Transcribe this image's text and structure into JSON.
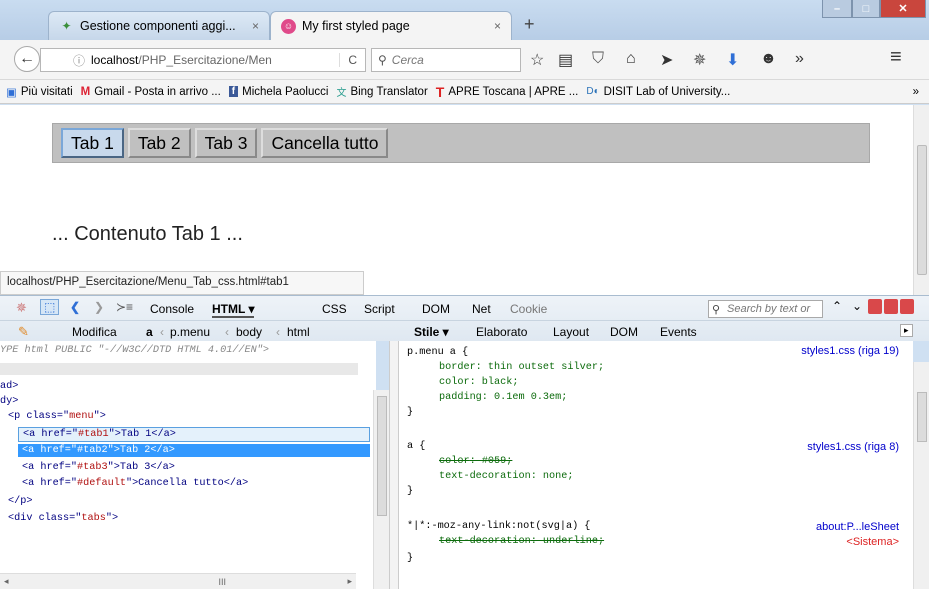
{
  "browser": {
    "tabs": [
      {
        "label": "Gestione componenti aggi...",
        "icon": "puzzle-icon",
        "close": "×"
      },
      {
        "label": "My first styled page",
        "icon": "page-icon",
        "close": "×"
      }
    ],
    "new_tab": "+",
    "url_host": "localhost",
    "url_path": "/PHP_Esercitazione/Men",
    "reload": "C",
    "search_placeholder": "Cerca",
    "overflow": "»",
    "menu": "≡"
  },
  "bookmarks": [
    {
      "label": "Più visitati",
      "icon": "visited-icon"
    },
    {
      "label": "Gmail - Posta in arrivo ...",
      "icon": "gmail-icon"
    },
    {
      "label": "Michela Paolucci",
      "icon": "facebook-icon"
    },
    {
      "label": "Bing Translator",
      "icon": "translate-icon"
    },
    {
      "label": "APRE Toscana | APRE ...",
      "icon": "apre-icon"
    },
    {
      "label": "DISIT Lab of University...",
      "icon": "disit-icon"
    }
  ],
  "page": {
    "menu_buttons": [
      "Tab 1",
      "Tab 2",
      "Tab 3",
      "Cancella tutto"
    ],
    "content": "... Contenuto Tab 1 ...",
    "status_url": "localhost/PHP_Esercitazione/Menu_Tab_css.html#tab1"
  },
  "firebug": {
    "toolbar_tabs": [
      "Console",
      "HTML ▾",
      "CSS",
      "Script",
      "DOM",
      "Net",
      "Cookie"
    ],
    "search_placeholder": "Search by text or",
    "edit": "Modifica",
    "breadcrumb": [
      "a",
      "p.menu",
      "body",
      "html"
    ],
    "side_tabs": [
      "Stile ▾",
      "Elaborato",
      "Layout",
      "DOM",
      "Events"
    ]
  },
  "html_lines": {
    "l1": "YPE html PUBLIC \"-//W3C//DTD HTML 4.01//EN\">",
    "l2": "ad>",
    "l3": "dy>",
    "p_open_a": "<p class=\"",
    "p_open_b": "menu",
    "p_open_c": "\">",
    "a1_a": "<a href=\"",
    "a1_b": "#tab1",
    "a1_c": "\">Tab 1</a>",
    "a2_a": "<a href=\"",
    "a2_b": "#tab2",
    "a2_c": "\">Tab 2</a>",
    "a3_a": "<a href=\"",
    "a3_b": "#tab3",
    "a3_c": "\">Tab 3</a>",
    "a4_a": "<a href=\"",
    "a4_b": "#default",
    "a4_c": "\">Cancella tutto</a>",
    "p_close": "</p>",
    "div_a": "<div class=\"",
    "div_b": "tabs",
    "div_c": "\">"
  },
  "style_rules": {
    "r1_selector": "p.menu a {",
    "r1_border": "border: thin outset silver;",
    "r1_color": "color: black;",
    "r1_padding": "padding: 0.1em 0.3em;",
    "r1_close": "}",
    "r1_src": "styles1.css (riga 19)",
    "r2_selector": "a {",
    "r2_color_prop": "color",
    "r2_color_val": ": #059;",
    "r2_td": "text-decoration: none;",
    "r2_close": "}",
    "r2_src": "styles1.css (riga 8)",
    "r3_selector": "*|*:-moz-any-link:not(svg|a) {",
    "r3_td_prop": "text-decoration",
    "r3_td_val": ": underline;",
    "r3_close": "}",
    "r3_src": "about:P...leSheet",
    "r3_src2": "<Sistema>"
  }
}
